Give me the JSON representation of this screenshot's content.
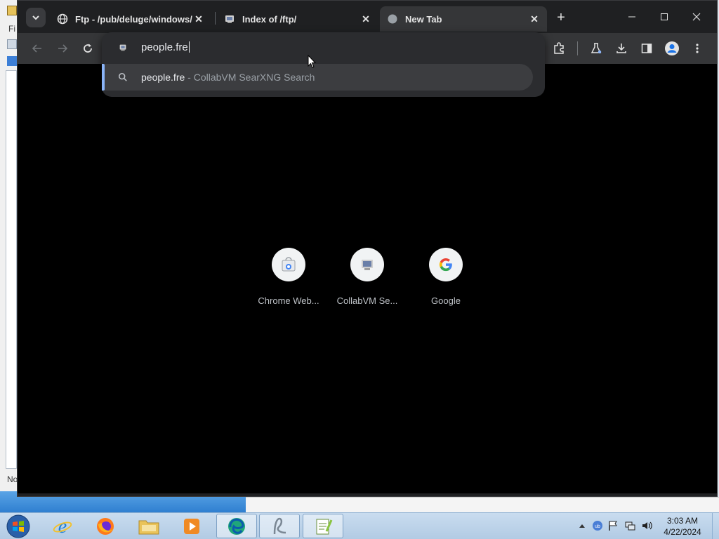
{
  "background_window": {
    "menu_letter": "Fi",
    "status_text": "No"
  },
  "browser": {
    "tabs": [
      {
        "title": "Ftp - /pub/deluge/windows/ ::",
        "active": false,
        "favicon": "globe-icon"
      },
      {
        "title": "Index of /ftp/",
        "active": false,
        "favicon": "collabvm-icon"
      },
      {
        "title": "New Tab",
        "active": true,
        "favicon": "globe-icon"
      }
    ],
    "new_tab_label": "+",
    "window_controls": {
      "minimize": "—",
      "maximize": "☐",
      "close": "✕"
    }
  },
  "omnibox": {
    "typed_text": "people.fre",
    "suggestion": {
      "query": "people.fre",
      "separator": " - ",
      "source": "CollabVM SearXNG Search"
    }
  },
  "shortcuts": [
    {
      "label": "Chrome Web...",
      "icon": "chrome-web-store-icon"
    },
    {
      "label": "CollabVM Se...",
      "icon": "collabvm-icon"
    },
    {
      "label": "Google",
      "icon": "google-icon"
    }
  ],
  "taskbar": {
    "apps": [
      "internet-explorer",
      "firefox",
      "file-explorer",
      "media-player",
      "edge",
      "app-generic",
      "notepad-plus-plus"
    ],
    "clock": {
      "time": "3:03 AM",
      "date": "4/22/2024"
    }
  },
  "colors": {
    "accent": "#8ab4f8",
    "content_bg": "#000000",
    "toolbar_bg": "#353638"
  }
}
